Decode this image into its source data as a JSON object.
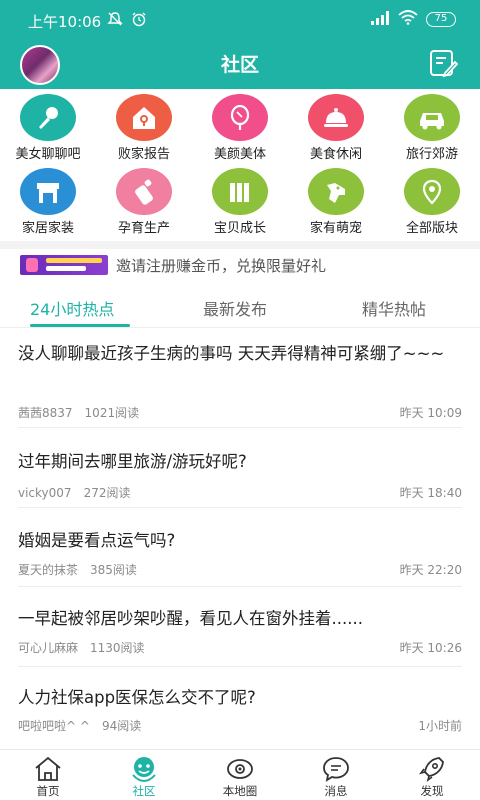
{
  "status_bar": {
    "time": "上午10:06",
    "battery": "75"
  },
  "header": {
    "title": "社区"
  },
  "colors": {
    "accent": "#1fb3a5"
  },
  "categories": [
    {
      "label": "美女聊聊吧",
      "icon": "microphone-icon",
      "color": "#1fb3a5"
    },
    {
      "label": "败家报告",
      "icon": "shop-icon",
      "color": "#ee5e45"
    },
    {
      "label": "美颜美体",
      "icon": "mirror-icon",
      "color": "#f04f8b"
    },
    {
      "label": "美食休闲",
      "icon": "dish-icon",
      "color": "#f0506a"
    },
    {
      "label": "旅行郊游",
      "icon": "car-icon",
      "color": "#8dc13b"
    },
    {
      "label": "家居家装",
      "icon": "store-icon",
      "color": "#2b8fd6"
    },
    {
      "label": "孕育生产",
      "icon": "bottle-icon",
      "color": "#f07fa0"
    },
    {
      "label": "宝贝成长",
      "icon": "books-icon",
      "color": "#8dc13b"
    },
    {
      "label": "家有萌宠",
      "icon": "dog-icon",
      "color": "#8dc13b"
    },
    {
      "label": "全部版块",
      "icon": "location-icon",
      "color": "#8dc13b"
    }
  ],
  "banner": {
    "text": "邀请注册赚金币，兑换限量好礼"
  },
  "tabs": [
    {
      "label": "24小时热点"
    },
    {
      "label": "最新发布"
    },
    {
      "label": "精华热帖"
    }
  ],
  "posts": [
    {
      "title": "没人聊聊最近孩子生病的事吗 天天弄得精神可紧绷了~~~",
      "author": "茜茜8837",
      "reads": "1021阅读",
      "time": "昨天 10:09"
    },
    {
      "title": "过年期间去哪里旅游/游玩好呢?",
      "author": "vicky007",
      "reads": "272阅读",
      "time": "昨天 18:40"
    },
    {
      "title": "婚姻是要看点运气吗?",
      "author": "夏天的抹茶",
      "reads": "385阅读",
      "time": "昨天 22:20"
    },
    {
      "title": "一早起被邻居吵架吵醒，看见人在窗外挂着......",
      "author": "可心儿麻麻",
      "reads": "1130阅读",
      "time": "昨天 10:26"
    },
    {
      "title": "人力社保app医保怎么交不了呢?",
      "author": "吧啦吧啦^ ^",
      "reads": "94阅读",
      "time": "1小时前"
    }
  ],
  "bottom_nav": [
    {
      "label": "首页",
      "icon": "home-icon"
    },
    {
      "label": "社区",
      "icon": "community-icon"
    },
    {
      "label": "本地圈",
      "icon": "eye-icon"
    },
    {
      "label": "消息",
      "icon": "message-icon"
    },
    {
      "label": "发现",
      "icon": "rocket-icon"
    }
  ]
}
